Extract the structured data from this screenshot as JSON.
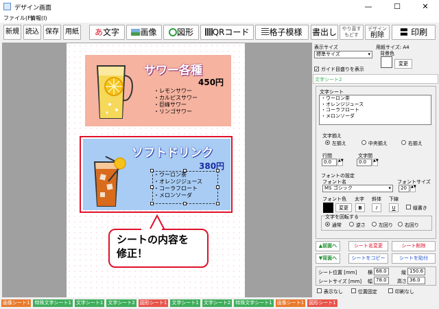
{
  "window": {
    "title": "デザイン画面",
    "minimize": "—",
    "maximize": "☐",
    "close": "✕"
  },
  "menu": {
    "file": "ファイル(F)",
    "info": "情報(I)"
  },
  "toolbar": {
    "new": "新規",
    "load": "読込",
    "save": "保存",
    "paper": "用紙",
    "text": "文字",
    "text_icon": "あ",
    "image": "画像",
    "shape": "図形",
    "qr": "QRコード",
    "grid": "格子模様",
    "print_out": "書出し",
    "redo_top": "やり直す",
    "redo_bottom": "もどす",
    "design_top": "デザイン",
    "design_bottom": "削除",
    "print": "印刷"
  },
  "canvas": {
    "sheet1": {
      "title": "サワー各種",
      "price": "450円",
      "items": "・レモンサワー\n・カルピスサワー\n・巨峰サワー\n・リンゴサワー"
    },
    "sheet2": {
      "title": "ソフトドリンク",
      "price": "380円",
      "items": "・ウーロン茶\n・オレンジジュース\n・コーラフロート\n・メロンソーダ"
    },
    "callout": "シートの内容を\n修正！"
  },
  "panel": {
    "display_size_label": "表示サイズ",
    "display_size_value": "標準サイズ",
    "paper_size_label": "用紙サイズ: A4",
    "bg_color_label": "背景色",
    "change": "変更",
    "guide_label": "ガイド目盛りを表示",
    "sheet_name": "文字シート2",
    "text_sheet_label": "文字シート",
    "text_lines": "・ウーロン茶\n・オレンジジュース\n・コーラフロート\n・メロンソーダ",
    "align_label": "文字揃え",
    "align_left": "左揃え",
    "align_center": "中央揃え",
    "align_right": "右揃え",
    "line_gap_label": "行間",
    "line_gap_value": "0.0",
    "char_gap_label": "文字間",
    "char_gap_value": "0.0",
    "font_setting_label": "フォントの設定",
    "font_name_label": "フォント名",
    "font_name_value": "MS ゴシック",
    "font_size_label": "フォントサイズ",
    "font_size_value": "20",
    "font_color_label": "フォント色",
    "bold_label": "太字",
    "italic_label": "斜体",
    "underline_label": "下線",
    "bold": "B",
    "italic": "I",
    "underline": "U",
    "vertical_label": "縦書き",
    "rotate_label": "文字を回転する",
    "rot_normal": "通常",
    "rot_reverse": "逆さ",
    "rot_left": "左回り",
    "rot_right": "右回り",
    "front": "▲前面へ",
    "back": "▼背面へ",
    "rename": "シート名変更",
    "delete": "シート削除",
    "copy": "シートをコピー",
    "paste": "シートを貼付",
    "pos_label": "シート位置 [mm]",
    "horiz_label": "横",
    "horiz_value": "68.0",
    "vert_label": "縦",
    "vert_value": "150.6",
    "size_label": "シートサイズ [mm]",
    "width_label": "幅",
    "width_value": "78.0",
    "height_label": "高さ",
    "height_value": "36.0",
    "hide_label": "表示なし",
    "lock_label": "位置固定",
    "noprint_label": "印刷なし"
  },
  "tabs": [
    {
      "label": "画像シート1",
      "color": "#e87a2e"
    },
    {
      "label": "特殊文字シート1",
      "color": "#3fae5c"
    },
    {
      "label": "文字シート1",
      "color": "#3fae5c"
    },
    {
      "label": "文字シート2",
      "color": "#3fae5c"
    },
    {
      "label": "図形シート1",
      "color": "#e8544b"
    },
    {
      "label": "文字シート1",
      "color": "#3fae5c"
    },
    {
      "label": "文字シート2",
      "color": "#3fae5c"
    },
    {
      "label": "特殊文字シート1",
      "color": "#3fae5c"
    },
    {
      "label": "画像シート1",
      "color": "#e87a2e"
    },
    {
      "label": "図形シート1",
      "color": "#e8544b"
    }
  ]
}
